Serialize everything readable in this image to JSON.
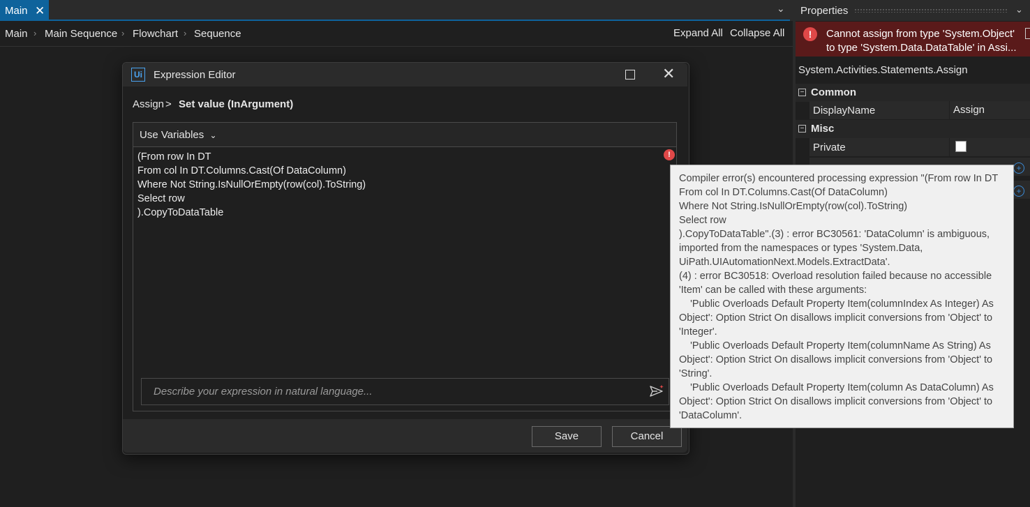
{
  "tabs": [
    {
      "label": "Main"
    }
  ],
  "breadcrumb": {
    "items": [
      "Main",
      "Main Sequence",
      "Flowchart",
      "Sequence"
    ]
  },
  "toolbar": {
    "expand_all": "Expand All",
    "collapse_all": "Collapse All"
  },
  "properties": {
    "title": "Properties",
    "error": {
      "line1": "Cannot assign from type 'System.Object'",
      "line2": "to type 'System.Data.DataTable' in Assi..."
    },
    "type_name": "System.Activities.Statements.Assign",
    "categories": [
      {
        "label": "Common",
        "rows": [
          {
            "name": "DisplayName",
            "value": "Assign"
          }
        ]
      },
      {
        "label": "Misc",
        "rows": [
          {
            "name": "Private",
            "value": false
          }
        ]
      }
    ]
  },
  "dialog": {
    "title": "Expression Editor",
    "logo": "Ui",
    "crumb": {
      "parent": "Assign",
      "separator": ">",
      "current": "Set value (InArgument)"
    },
    "use_variables": "Use Variables",
    "code": "(From row In DT\nFrom col In DT.Columns.Cast(Of DataColumn)\nWhere Not String.IsNullOrEmpty(row(col).ToString)\nSelect row\n).CopyToDataTable",
    "nl_placeholder": "Describe your expression in natural language...",
    "save": "Save",
    "cancel": "Cancel"
  },
  "tooltip": {
    "lines": [
      "Compiler error(s) encountered processing expression \"(From row In DT",
      "From col In DT.Columns.Cast(Of DataColumn)",
      "Where Not String.IsNullOrEmpty(row(col).ToString)",
      "Select row",
      ").CopyToDataTable\".(3) : error BC30561: 'DataColumn' is ambiguous,",
      "imported from the namespaces or types 'System.Data,",
      "UiPath.UIAutomationNext.Models.ExtractData'.",
      "(4) : error BC30518: Overload resolution failed because no accessible",
      "'Item' can be called with these arguments:",
      "    'Public Overloads Default Property Item(columnIndex As Integer) As",
      "Object': Option Strict On disallows implicit conversions from 'Object' to",
      "'Integer'.",
      "    'Public Overloads Default Property Item(columnName As String) As",
      "Object': Option Strict On disallows implicit conversions from 'Object' to",
      "'String'.",
      "    'Public Overloads Default Property Item(column As DataColumn) As",
      "Object': Option Strict On disallows implicit conversions from 'Object' to",
      "'DataColumn'."
    ]
  },
  "colors": {
    "accent": "#0e639c",
    "error": "#e04848",
    "error_banner": "#5a1a1a"
  }
}
